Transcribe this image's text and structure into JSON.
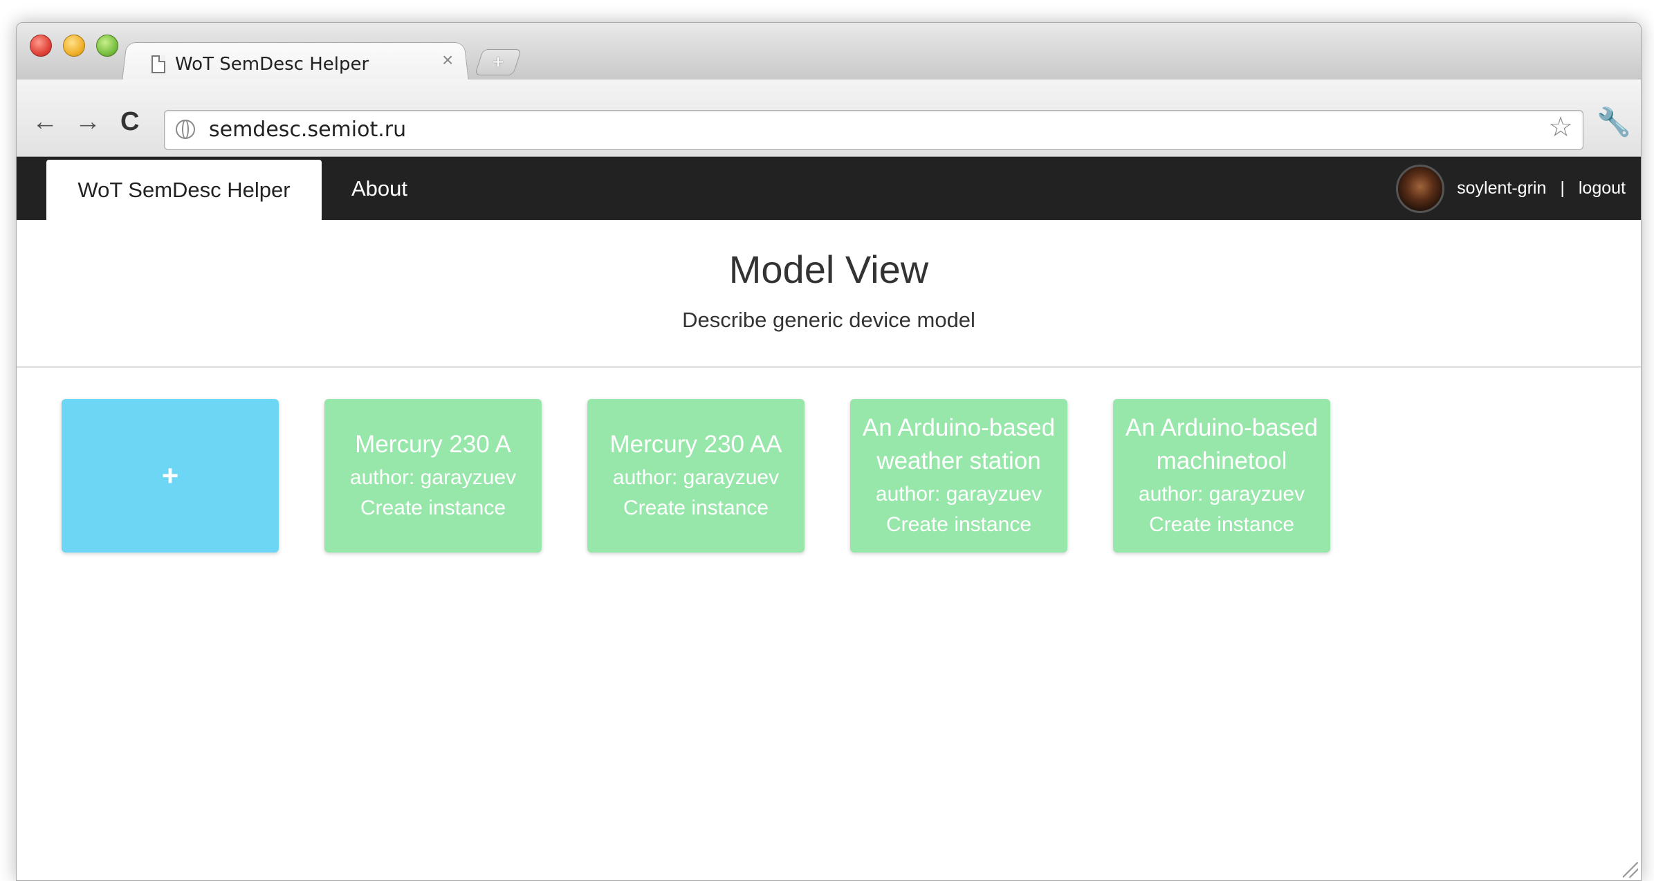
{
  "browser": {
    "tab_title": "WoT SemDesc Helper",
    "tab_close_icon": "×",
    "new_tab_icon": "+",
    "back_icon": "←",
    "forward_icon": "→",
    "reload_icon": "C",
    "url": "semdesc.semiot.ru",
    "bookmark_icon": "☆",
    "wrench_icon": "🔧"
  },
  "navbar": {
    "brand": "WoT SemDesc Helper",
    "about": "About",
    "username": "soylent-grin",
    "separator": "|",
    "logout": "logout"
  },
  "main": {
    "title": "Model View",
    "subtitle": "Describe generic device model",
    "add_label": "+",
    "models": [
      {
        "title": "Mercury 230 A",
        "author": "author: garayzuev",
        "action": "Create instance"
      },
      {
        "title": "Mercury 230 AA",
        "author": "author: garayzuev",
        "action": "Create instance"
      },
      {
        "title": "An Arduino-based weather station",
        "author": "author: garayzuev",
        "action": "Create instance"
      },
      {
        "title": "An Arduino-based machinetool",
        "author": "author: garayzuev",
        "action": "Create instance"
      }
    ]
  },
  "colors": {
    "navbar_bg": "#222222",
    "add_card": "#6dd6f4",
    "model_card": "#97e6aa"
  }
}
